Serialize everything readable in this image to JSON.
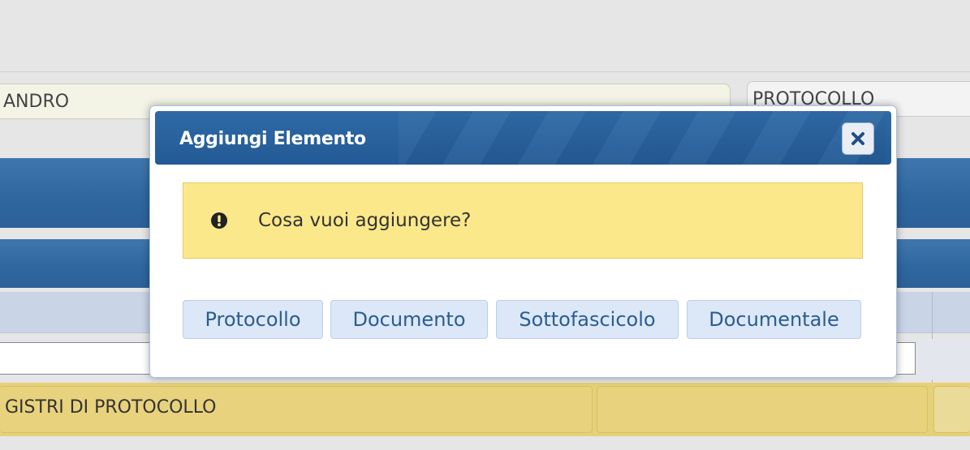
{
  "background": {
    "name_field": "ANDRO",
    "type_field": "PROTOCOLLO",
    "row_cell": "GISTRI DI PROTOCOLLO"
  },
  "dialog": {
    "title": "Aggiungi Elemento",
    "close_icon": "close-icon",
    "alert": {
      "icon": "exclamation-circle-icon",
      "message": "Cosa vuoi aggiungere?"
    },
    "buttons": {
      "protocollo": "Protocollo",
      "documento": "Documento",
      "sottofascicolo": "Sottofascicolo",
      "documentale": "Documentale"
    }
  },
  "colors": {
    "titlebar": "#235a95",
    "alert_bg": "#fbe88a",
    "button_bg": "#dce8f7",
    "button_text": "#2b5c92",
    "row_highlight": "#e6d17a"
  }
}
